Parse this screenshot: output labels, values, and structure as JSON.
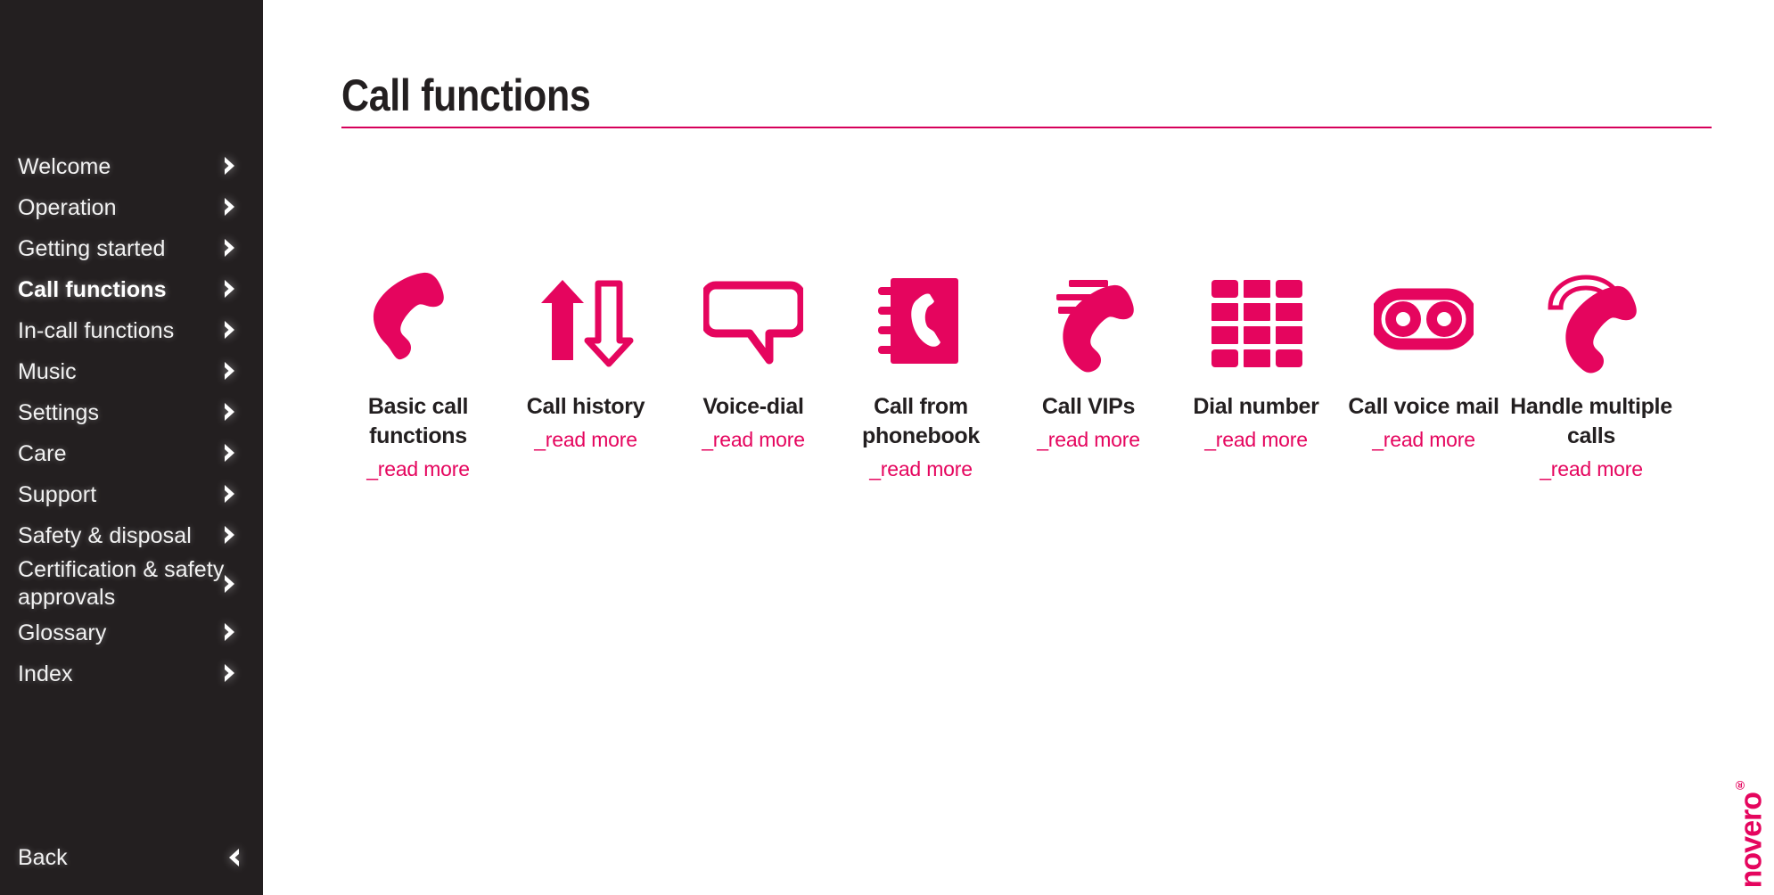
{
  "sidebar": {
    "items": [
      {
        "label": "Welcome",
        "active": false,
        "icon": "chevron-right-icon"
      },
      {
        "label": "Operation",
        "active": false,
        "icon": "chevron-right-icon"
      },
      {
        "label": "Getting started",
        "active": false,
        "icon": "chevron-right-icon"
      },
      {
        "label": "Call functions",
        "active": true,
        "icon": "chevron-right-icon"
      },
      {
        "label": "In-call functions",
        "active": false,
        "icon": "chevron-right-icon"
      },
      {
        "label": "Music",
        "active": false,
        "icon": "chevron-right-icon"
      },
      {
        "label": "Settings",
        "active": false,
        "icon": "chevron-right-icon"
      },
      {
        "label": "Care",
        "active": false,
        "icon": "chevron-right-icon"
      },
      {
        "label": "Support",
        "active": false,
        "icon": "chevron-right-icon"
      },
      {
        "label": "Safety & disposal",
        "active": false,
        "icon": "chevron-right-icon"
      },
      {
        "label": "Certification &\nsafety approvals",
        "active": false,
        "icon": "chevron-right-icon",
        "two_line": true
      },
      {
        "label": "Glossary",
        "active": false,
        "icon": "chevron-right-icon"
      },
      {
        "label": "Index",
        "active": false,
        "icon": "chevron-right-icon"
      }
    ],
    "back": {
      "label": "Back",
      "icon": "chevron-left-icon"
    }
  },
  "main": {
    "title": "Call functions",
    "tiles": [
      {
        "label": "Basic call functions",
        "link": "_read more",
        "icon": "phone-handset-icon"
      },
      {
        "label": "Call history",
        "link": "_read more",
        "icon": "up-down-arrows-icon"
      },
      {
        "label": "Voice-dial",
        "link": "_read more",
        "icon": "speech-bubble-icon"
      },
      {
        "label": "Call from phonebook",
        "link": "_read more",
        "icon": "phonebook-icon"
      },
      {
        "label": "Call VIPs",
        "link": "_read more",
        "icon": "incoming-call-icon"
      },
      {
        "label": "Dial number",
        "link": "_read more",
        "icon": "dialpad-icon"
      },
      {
        "label": "Call voice mail",
        "link": "_read more",
        "icon": "cassette-tape-icon"
      },
      {
        "label": "Handle multiple calls",
        "link": "_read more",
        "icon": "two-handsets-icon"
      }
    ]
  },
  "brand": {
    "name": "novero",
    "trademark": "®"
  },
  "colors": {
    "accent_pink": "#e5055e",
    "rule_pink": "#d6005a",
    "sidebar_bg": "#231f20",
    "text_dark": "#231f20",
    "sidebar_text": "#f2f2f2",
    "page_bg": "#ffffff"
  }
}
